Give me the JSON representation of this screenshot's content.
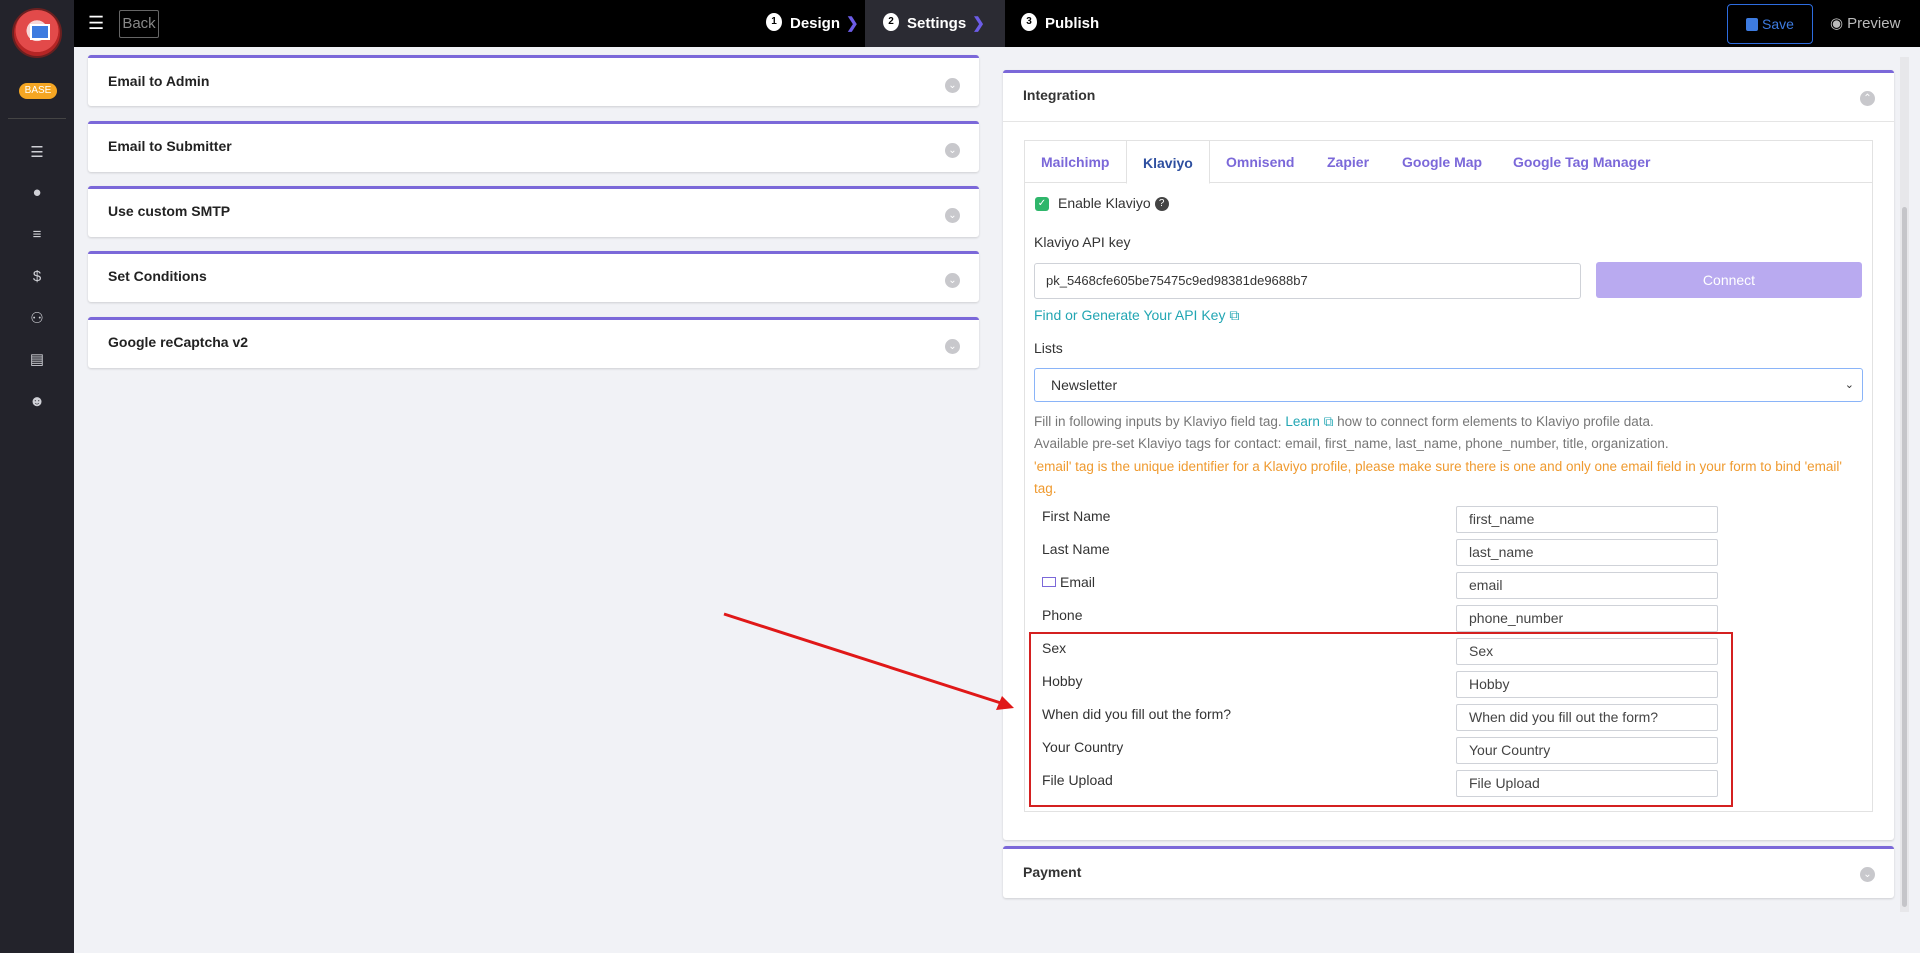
{
  "rail": {
    "badge": "BASE",
    "icons": [
      "list-icon",
      "user-icon",
      "menu-icon",
      "dollar-icon",
      "users-icon",
      "document-icon",
      "smile-icon"
    ]
  },
  "topbar": {
    "back_label": "Back",
    "steps": [
      {
        "num": "1",
        "label": "Design"
      },
      {
        "num": "2",
        "label": "Settings"
      },
      {
        "num": "3",
        "label": "Publish"
      }
    ],
    "save_label": "Save",
    "preview_label": "Preview"
  },
  "left_cards": [
    {
      "title": "Email to Admin"
    },
    {
      "title": "Email to Submitter"
    },
    {
      "title": "Use custom SMTP"
    },
    {
      "title": "Set Conditions"
    },
    {
      "title": "Google reCaptcha v2"
    }
  ],
  "integration": {
    "title": "Integration",
    "tabs": [
      "Mailchimp",
      "Klaviyo",
      "Omnisend",
      "Zapier",
      "Google Map",
      "Google Tag Manager"
    ],
    "active_tab": "Klaviyo",
    "enable_label": "Enable Klaviyo",
    "api_key_label": "Klaviyo API key",
    "api_key_value": "pk_5468cfe605be75475c9ed98381de9688b7",
    "connect_label": "Connect",
    "api_link": "Find or Generate Your API Key",
    "lists_label": "Lists",
    "lists_selected": "Newsletter",
    "info1_pre": "Fill in following inputs by Klaviyo field tag.",
    "info1_link": "Learn",
    "info1_post": "how to connect form elements to Klaviyo profile data.",
    "info2": "Available pre-set Klaviyo tags for contact: email, first_name, last_name, phone_number, title, organization.",
    "warning": "'email' tag is the unique identifier for a Klaviyo profile, please make sure there is one and only one email field in your form to bind 'email' tag.",
    "fields": [
      {
        "label": "First Name",
        "value": "first_name"
      },
      {
        "label": "Last Name",
        "value": "last_name"
      },
      {
        "label": "Email",
        "value": "email"
      },
      {
        "label": "Phone",
        "value": "phone_number"
      },
      {
        "label": "Sex",
        "value": "Sex"
      },
      {
        "label": "Hobby",
        "value": "Hobby"
      },
      {
        "label": "When did you fill out the form?",
        "value": "When did you fill out the form?"
      },
      {
        "label": "Your Country",
        "value": "Your Country"
      },
      {
        "label": "File Upload",
        "value": "File Upload"
      }
    ]
  },
  "payment": {
    "title": "Payment"
  },
  "colors": {
    "accent": "#7b68d9",
    "link": "#22a6b3",
    "warning": "#ef9a2f",
    "highlight": "#d42020"
  }
}
